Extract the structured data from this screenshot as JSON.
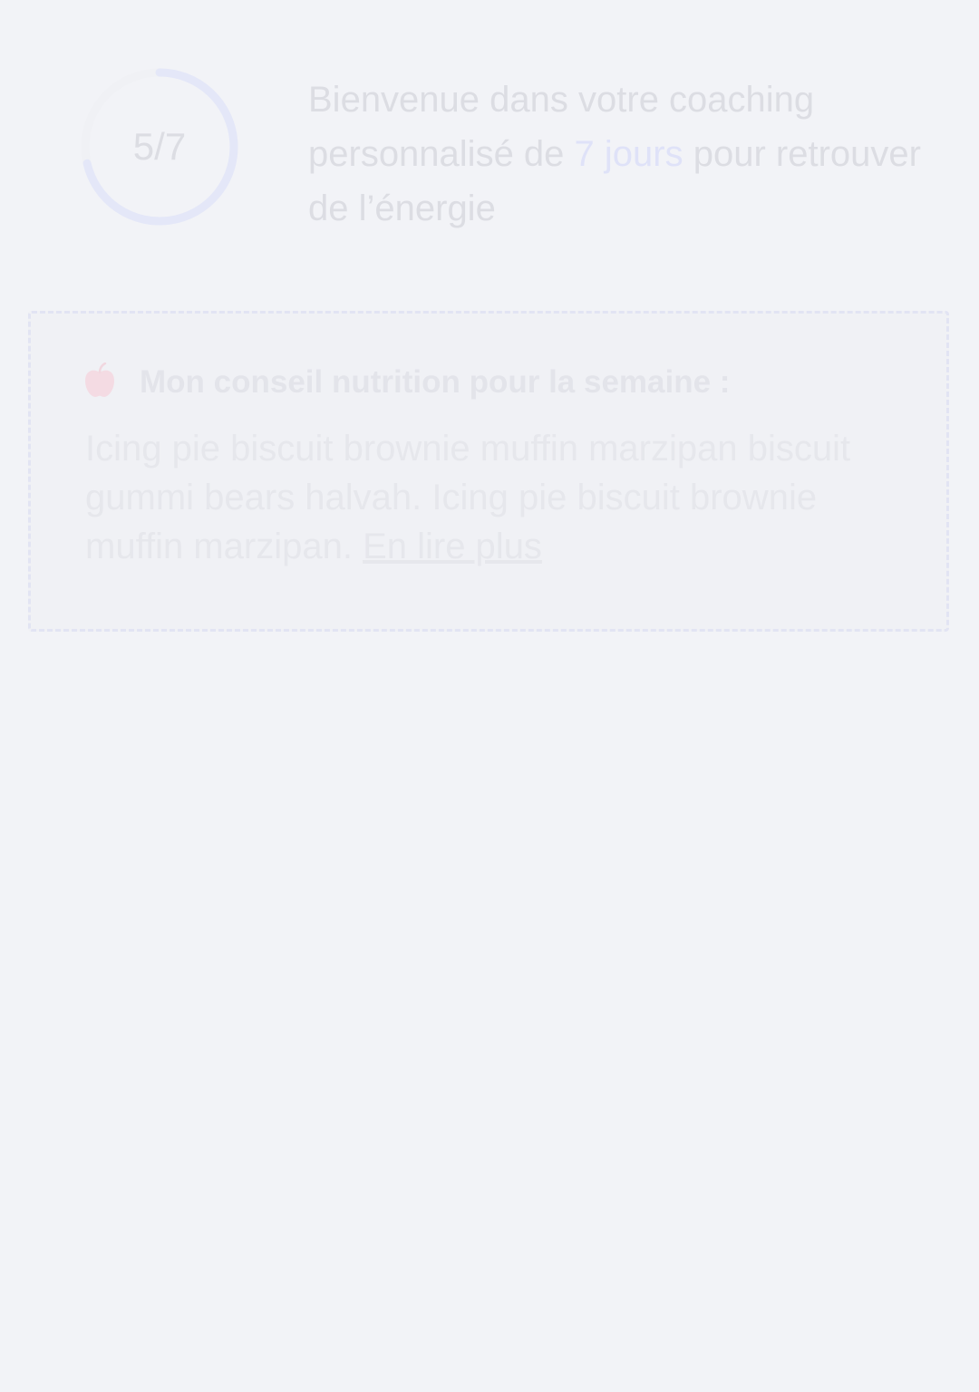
{
  "progress": {
    "current": 5,
    "total": 7,
    "label": "5/7",
    "fraction": 0.714,
    "track_color": "#f0f1f5",
    "arc_color": "#e4e7f8"
  },
  "welcome": {
    "text_before": "Bienvenue dans votre coaching personnalisé de ",
    "highlight": "7 jours",
    "text_after": " pour retrouver de l’énergie",
    "highlight_color": "#dfe2f8"
  },
  "tip": {
    "icon": "apple-icon",
    "icon_color": "#f4dbe3",
    "title": "Mon conseil nutrition pour la semaine :",
    "body": "Icing pie biscuit brownie muffin marzipan biscuit gummi bears halvah. Icing pie biscuit brownie muffin marzipan. ",
    "read_more": "En lire plus"
  }
}
